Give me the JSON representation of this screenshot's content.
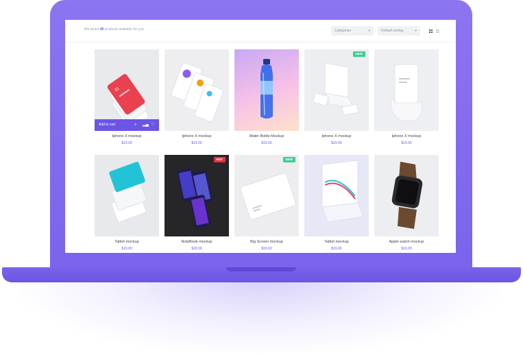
{
  "header": {
    "found_prefix": "We found",
    "found_count": "45",
    "found_suffix": "products available for you",
    "categories_select": "Categories",
    "sort_select": "Default sorting"
  },
  "view_icons": {
    "grid": "grid-view-icon",
    "list": "list-view-icon"
  },
  "cart": {
    "label": "Add to cart",
    "icons": [
      "search-icon",
      "bar-chart-icon",
      "heart-icon"
    ]
  },
  "colors": {
    "accent": "#6a55e6",
    "new_badge": "#3ccf8e",
    "hot_badge": "#e8303c",
    "laptop": "#7b63ec"
  },
  "products": [
    {
      "name": "Iphone X mockup",
      "price": "$19.00",
      "badge": "",
      "bg": "#e9eaee",
      "hover": true
    },
    {
      "name": "Iphone X mockup",
      "price": "$19.00",
      "badge": "",
      "bg": "#eeeef1"
    },
    {
      "name": "Water Bottle Mockup",
      "price": "$19.00",
      "badge": "",
      "bg": "#f7c2e6"
    },
    {
      "name": "Iphone X mockup",
      "price": "$19.00",
      "badge": "NEW",
      "bg": "#eceef1"
    },
    {
      "name": "Iphone X mockup",
      "price": "$19.00",
      "badge": "",
      "bg": "#eeeff2"
    },
    {
      "name": "Tablet mockup",
      "price": "$19.00",
      "badge": "",
      "bg": "#e8e9ed"
    },
    {
      "name": "NoteBook mockup",
      "price": "$29.00",
      "badge": "HOT",
      "bg": "#262629"
    },
    {
      "name": "Big Screen mockup",
      "price": "$19.00",
      "badge": "NEW",
      "bg": "#ededf0"
    },
    {
      "name": "Tablet mockup",
      "price": "$19.00",
      "badge": "",
      "bg": "#e6e8f6"
    },
    {
      "name": "Apple watch mockup",
      "price": "$19.00",
      "badge": "",
      "bg": "#eceef1"
    }
  ]
}
